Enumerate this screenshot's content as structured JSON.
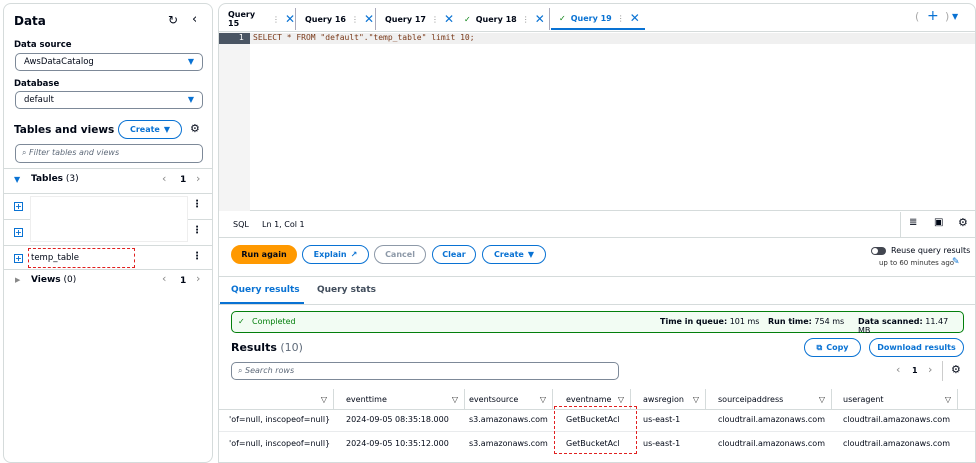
{
  "sidebar": {
    "title": "Data",
    "data_source_label": "Data source",
    "data_source_value": "AwsDataCatalog",
    "database_label": "Database",
    "database_value": "default",
    "tables_views_title": "Tables and views",
    "create_label": "Create",
    "filter_placeholder": "Filter tables and views",
    "tables_label": "Tables",
    "tables_count": "(3)",
    "tables_page": "1",
    "table_items": [
      "",
      "",
      "temp_table"
    ],
    "views_label": "Views",
    "views_count": "(0)",
    "views_page": "1"
  },
  "tabs": [
    {
      "label": "Query 15",
      "status": ""
    },
    {
      "label": "Query 16",
      "status": ""
    },
    {
      "label": "Query 17",
      "status": ""
    },
    {
      "label": "Query 18",
      "status": "success"
    },
    {
      "label": "Query 19",
      "status": "success",
      "active": true
    }
  ],
  "editor": {
    "line_number": "1",
    "code": "SELECT * FROM \"default\".\"temp_table\" limit 10;",
    "language": "SQL",
    "cursor": "Ln 1, Col 1"
  },
  "actions": {
    "run": "Run again",
    "explain": "Explain",
    "cancel": "Cancel",
    "clear": "Clear",
    "create": "Create",
    "reuse_label": "Reuse query results",
    "reuse_sub": "up to 60 minutes ago"
  },
  "result_tabs": [
    "Query results",
    "Query stats"
  ],
  "status": {
    "text": "Completed",
    "queue_label": "Time in queue:",
    "queue_value": "101 ms",
    "run_label": "Run time:",
    "run_value": "754 ms",
    "scan_label": "Data scanned:",
    "scan_value": "11.47 MB"
  },
  "results": {
    "title": "Results",
    "count": "(10)",
    "copy": "Copy",
    "download": "Download results",
    "search_placeholder": "Search rows",
    "page": "1",
    "columns": [
      "",
      "eventtime",
      "eventsource",
      "eventname",
      "awsregion",
      "sourceipaddress",
      "useragent"
    ],
    "rows": [
      [
        "'of=null, inscopeof=null}",
        "2024-09-05 08:35:18.000",
        "s3.amazonaws.com",
        "GetBucketAcl",
        "us-east-1",
        "cloudtrail.amazonaws.com",
        "cloudtrail.amazonaws.com"
      ],
      [
        "'of=null, inscopeof=null}",
        "2024-09-05 10:35:12.000",
        "s3.amazonaws.com",
        "GetBucketAcl",
        "us-east-1",
        "cloudtrail.amazonaws.com",
        "cloudtrail.amazonaws.com"
      ]
    ]
  },
  "colors": {
    "accent": "#0972d3",
    "run": "#ff9900",
    "success": "#037f0c",
    "highlight": "#e02020"
  }
}
